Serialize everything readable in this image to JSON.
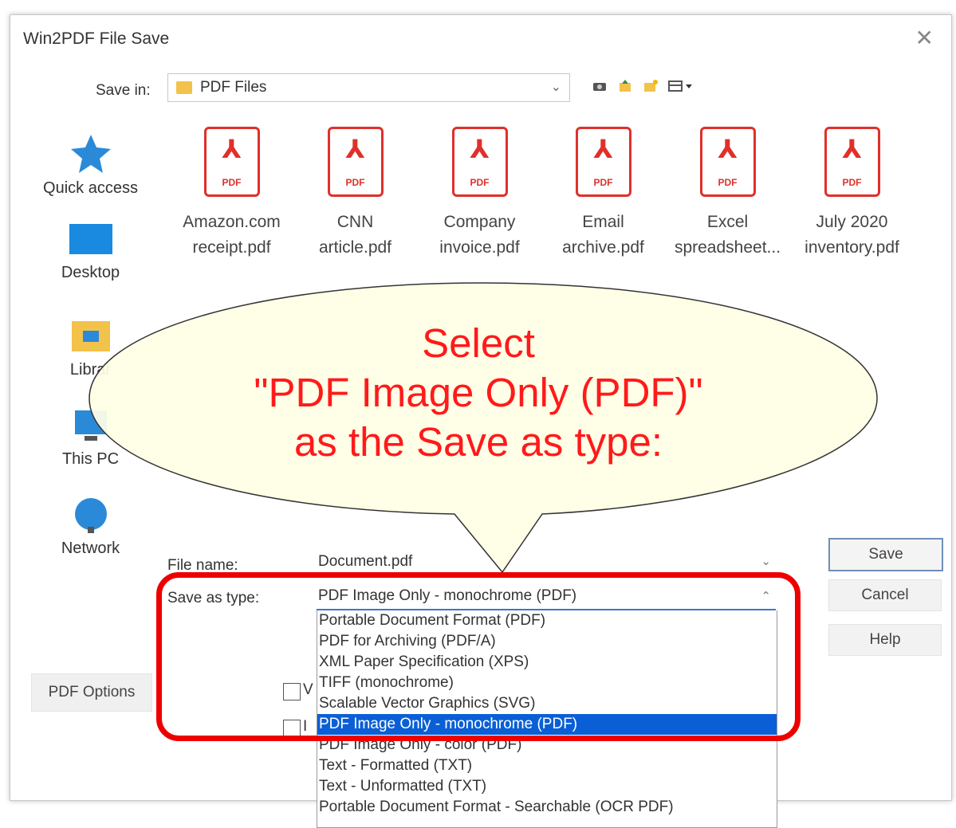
{
  "window": {
    "title": "Win2PDF File Save",
    "close_glyph": "✕"
  },
  "save_in": {
    "label": "Save in:",
    "value": "PDF Files"
  },
  "toolbar": {
    "icons": [
      "back-icon",
      "up-folder-icon",
      "new-folder-icon",
      "view-menu-icon"
    ]
  },
  "places": [
    {
      "label": "Quick access",
      "icon": "star-icon"
    },
    {
      "label": "Desktop",
      "icon": "desktop-icon"
    },
    {
      "label": "Librar",
      "icon": "libraries-icon"
    },
    {
      "label": "This PC",
      "icon": "computer-icon"
    },
    {
      "label": "Network",
      "icon": "network-icon"
    }
  ],
  "files": [
    {
      "line1": "Amazon.com",
      "line2": "receipt.pdf"
    },
    {
      "line1": "CNN",
      "line2": "article.pdf"
    },
    {
      "line1": "Company",
      "line2": "invoice.pdf"
    },
    {
      "line1": "Email",
      "line2": "archive.pdf"
    },
    {
      "line1": "Excel",
      "line2": "spreadsheet..."
    },
    {
      "line1": "July 2020",
      "line2": "inventory.pdf"
    }
  ],
  "pdf_tag": "PDF",
  "callout": {
    "line1": "Select",
    "line2": "\"PDF Image Only (PDF)\"",
    "line3": "as the Save as type:",
    "fill": "#ffffe6",
    "text_color": "#ff1a1a"
  },
  "file_name": {
    "label": "File name:",
    "value": "Document.pdf"
  },
  "save_as_type": {
    "label": "Save as type:",
    "value": "PDF Image Only - monochrome (PDF)",
    "options": [
      "Portable Document Format (PDF)",
      "PDF for Archiving (PDF/A)",
      "XML Paper Specification (XPS)",
      "TIFF (monochrome)",
      "Scalable Vector Graphics (SVG)",
      "PDF Image Only - monochrome (PDF)",
      "PDF Image Only - color (PDF)",
      "Text - Formatted (TXT)",
      "Text - Unformatted (TXT)",
      "Portable Document Format - Searchable (OCR PDF)"
    ],
    "selected_index": 5
  },
  "buttons": {
    "save": "Save",
    "cancel": "Cancel",
    "help": "Help",
    "pdf_options": "PDF Options"
  },
  "checkboxes": [
    {
      "label": "V"
    },
    {
      "label": "I"
    }
  ],
  "colors": {
    "highlight_border": "#ee0000",
    "selection": "#0a5fd6",
    "pdf_red": "#e0302a"
  }
}
